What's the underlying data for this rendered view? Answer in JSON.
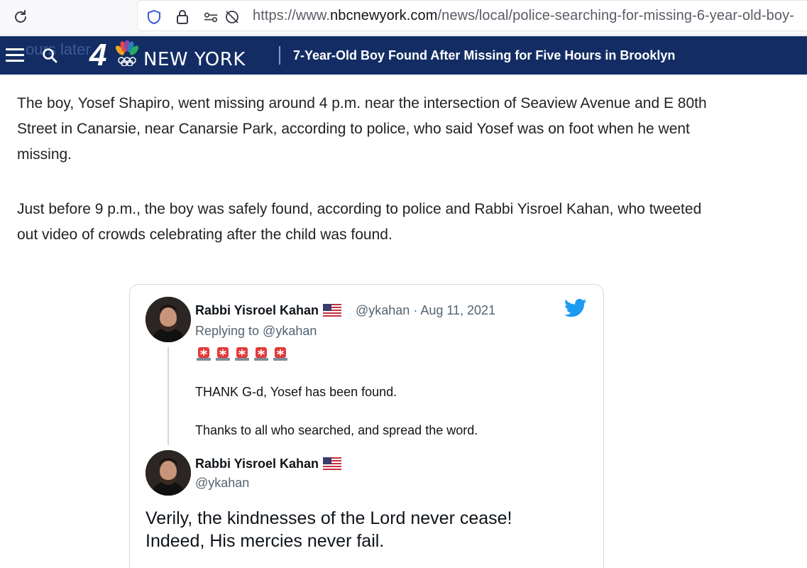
{
  "browser": {
    "url_prefix": "https://www.",
    "url_host": "nbcnewyork.com",
    "url_path": "/news/local/police-searching-for-missing-6-year-old-boy-"
  },
  "site": {
    "ghost_text": "ours later",
    "logo_number": "4",
    "logo_text": "NEW YORK",
    "headline": "7-Year-Old Boy Found After Missing for Five Hours in Brooklyn",
    "brand_color": "#132d64"
  },
  "article": {
    "paragraphs": [
      "The boy, Yosef Shapiro, went missing around 4 p.m. near the intersection of Seaview Avenue and E 80th Street in Canarsie, near Canarsie Park, according to police, who said Yosef was on foot when he went missing.",
      "Just before 9 p.m., the boy was safely found, according to police and Rabbi Yisroel Kahan, who tweeted out video of crowds celebrating after the child was found."
    ]
  },
  "tweet": {
    "author_name": "Rabbi Yisroel Kahan",
    "handle_meta": "@ykahan · Aug 11, 2021",
    "replying_to": "Replying to @ykahan",
    "body_line1": "THANK G-d, Yosef has been found.",
    "body_line2": "Thanks to all who searched, and spread the word.",
    "quoted": {
      "author_name": "Rabbi Yisroel Kahan",
      "handle": "@ykahan",
      "text_line1": "Verily, the kindnesses of the Lord never cease!",
      "text_line2": "Indeed, His mercies never fail."
    },
    "twitter_color": "#1d9bf0"
  },
  "icons": [
    "reload-icon",
    "shield-icon",
    "lock-icon",
    "permissions-icon",
    "tracking-blocked-icon",
    "hamburger-menu-icon",
    "search-icon",
    "nbc-peacock-icon",
    "us-flag-icon",
    "police-light-icon",
    "twitter-bird-icon"
  ]
}
